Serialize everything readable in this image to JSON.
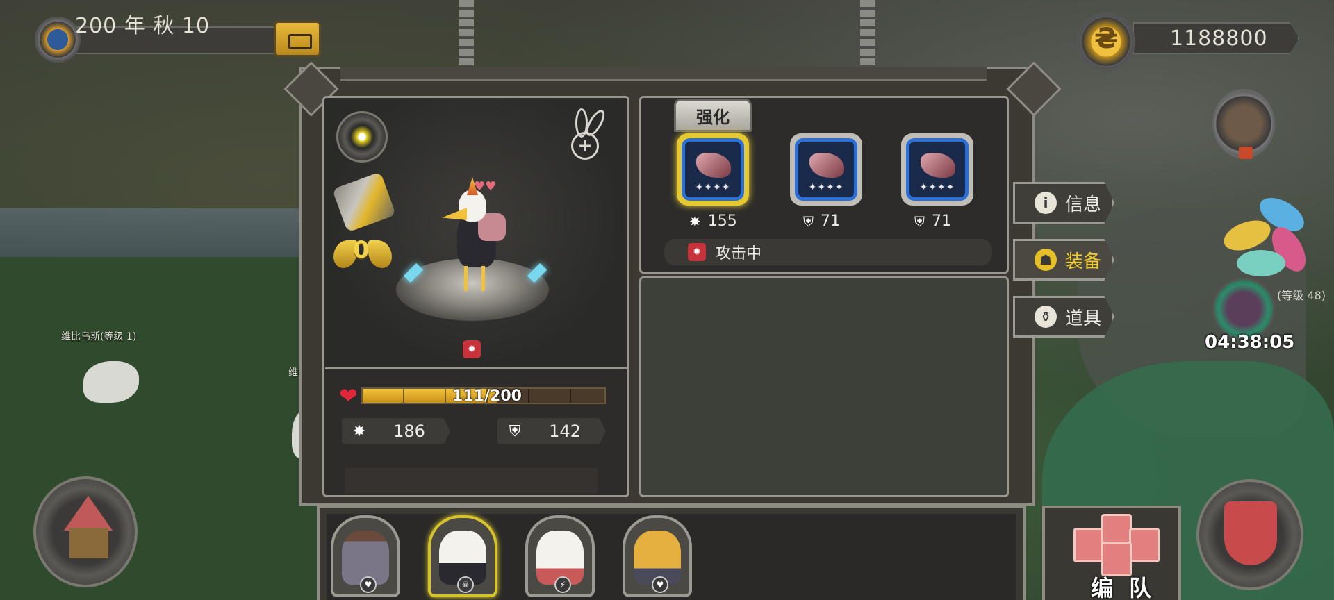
{
  "top_bar": {
    "date_text": "200 年 秋 10",
    "coins": "1188800"
  },
  "world": {
    "npc_left_name": "维比乌斯(等级 1)",
    "npc_mid_name": "维比乌",
    "boss_level": "(等级 48)",
    "boss_timer": "04:38:05"
  },
  "side_tabs": [
    {
      "label": "信息",
      "icon": "info-icon",
      "active": false
    },
    {
      "label": "装备",
      "icon": "equipment-icon",
      "active": true
    },
    {
      "label": "道具",
      "icon": "item-icon",
      "active": false
    }
  ],
  "hero": {
    "rank": "0",
    "hp_current": 111,
    "hp_max": 200,
    "hp_text": "111/200",
    "attack": "186",
    "defense": "142"
  },
  "equipment": {
    "tab_label": "强化",
    "slots": [
      {
        "stat_icon": "attack-icon",
        "value": "155",
        "stars": "✦✦✦✦",
        "selected": true
      },
      {
        "stat_icon": "defense-icon",
        "value": "71",
        "stars": "✦✦✦✦",
        "selected": false
      },
      {
        "stat_icon": "defense-icon",
        "value": "71",
        "stars": "✦✦✦✦",
        "selected": false
      }
    ],
    "status_text": "攻击中"
  },
  "roster": {
    "heroes": [
      {
        "name": "hero-card-rhino",
        "selected": false
      },
      {
        "name": "hero-card-bird",
        "selected": true
      },
      {
        "name": "hero-card-polar-bear",
        "selected": false
      },
      {
        "name": "hero-card-leopard",
        "selected": false
      }
    ],
    "team_label": "编 队"
  },
  "colors": {
    "accent_gold": "#e6c028",
    "slot_blue": "#2b6fd8",
    "hp_red": "#e0283a"
  }
}
